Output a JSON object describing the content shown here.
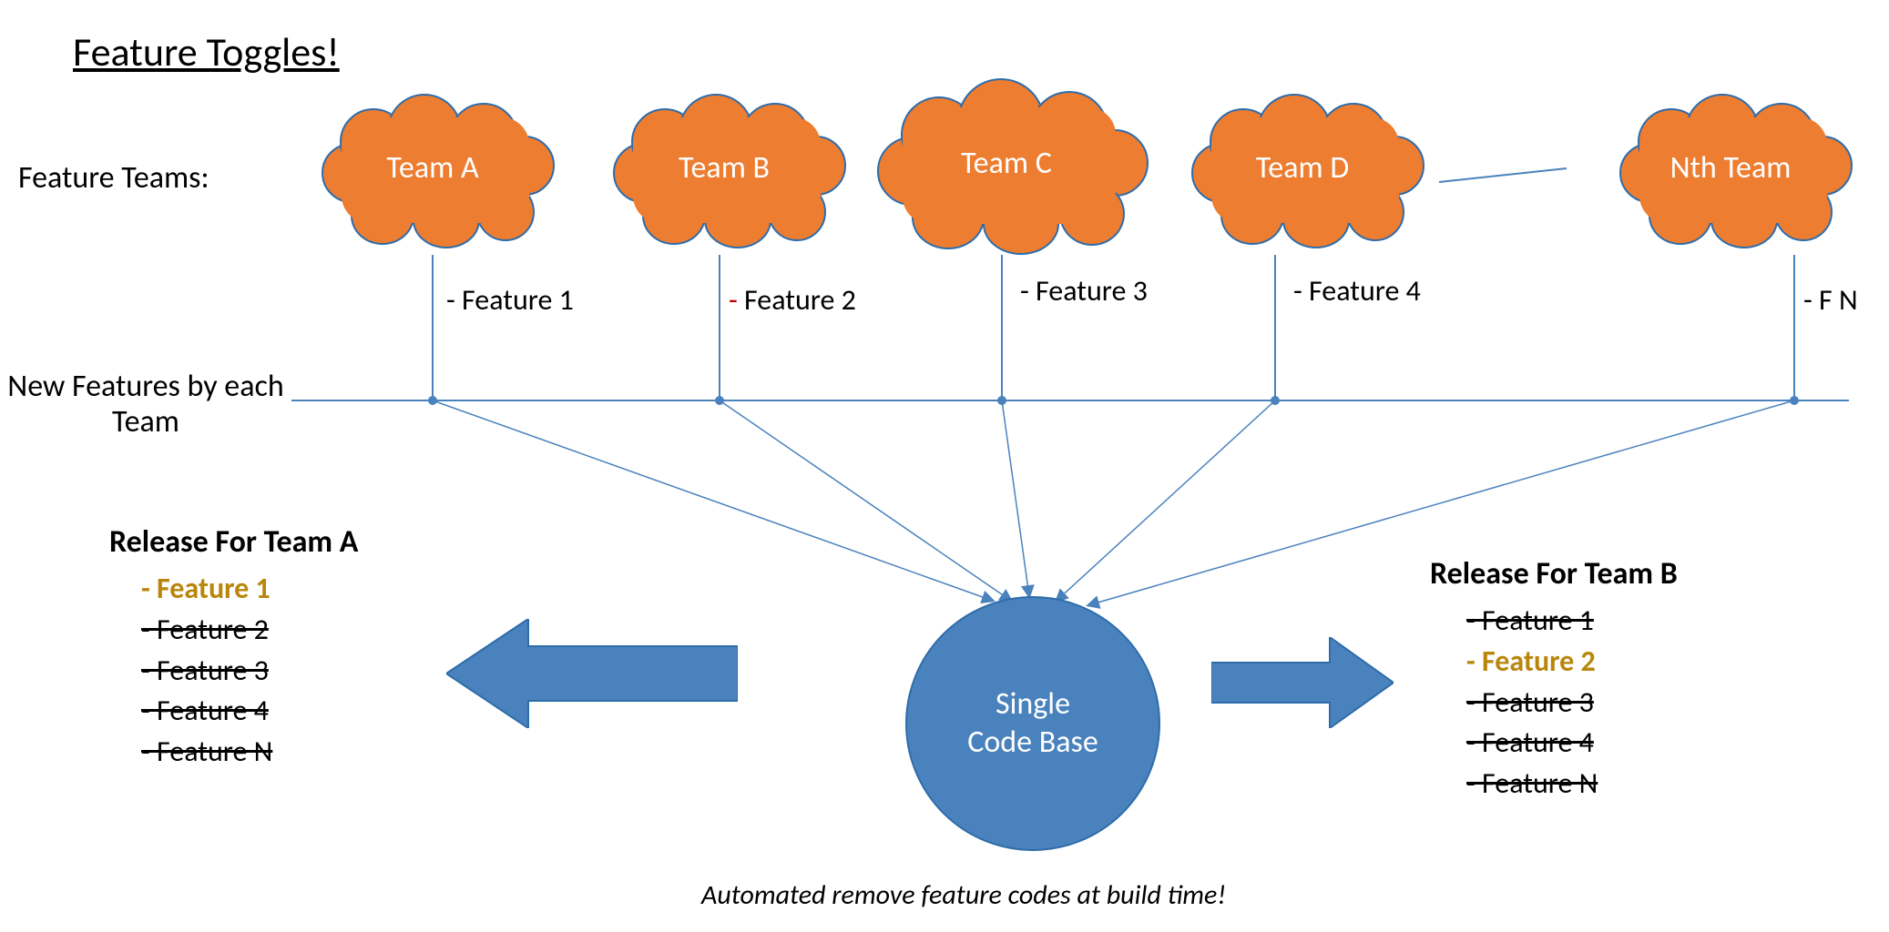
{
  "title": "Feature Toggles!",
  "labels": {
    "feature_teams": "Feature Teams:",
    "new_features_by_each_team": "New Features by each Team",
    "release_team_a": "Release For Team A",
    "release_team_b": "Release For Team B",
    "single_code_base": "Single\nCode Base",
    "caption": "Automated remove feature codes at build time!"
  },
  "teams": [
    {
      "name": "Team A",
      "feature": "- Feature 1",
      "dash_color": "black"
    },
    {
      "name": "Team B",
      "feature": "- Feature 2",
      "dash_color": "red"
    },
    {
      "name": "Team C",
      "feature": "- Feature 3",
      "dash_color": "black"
    },
    {
      "name": "Team D",
      "feature": "- Feature 4",
      "dash_color": "black"
    },
    {
      "name": "Nth Team",
      "feature": "- F N",
      "dash_color": "black"
    }
  ],
  "release_a": [
    {
      "text": "- Feature 1",
      "enabled": true
    },
    {
      "text": "- Feature 2",
      "enabled": false
    },
    {
      "text": "- Feature 3",
      "enabled": false
    },
    {
      "text": "- Feature 4",
      "enabled": false
    },
    {
      "text": "- Feature N",
      "enabled": false
    }
  ],
  "release_b": [
    {
      "text": "- Feature 1",
      "enabled": false
    },
    {
      "text": "- Feature 2",
      "enabled": true
    },
    {
      "text": "- Feature 3",
      "enabled": false
    },
    {
      "text": "- Feature 4",
      "enabled": false
    },
    {
      "text": "- Feature N",
      "enabled": false
    }
  ],
  "colors": {
    "cloud_fill": "#ED7D31",
    "cloud_border": "#2E6CAA",
    "line": "#4A82BD",
    "arrow_fill": "#4A82BD",
    "highlight": "#B8860B"
  }
}
